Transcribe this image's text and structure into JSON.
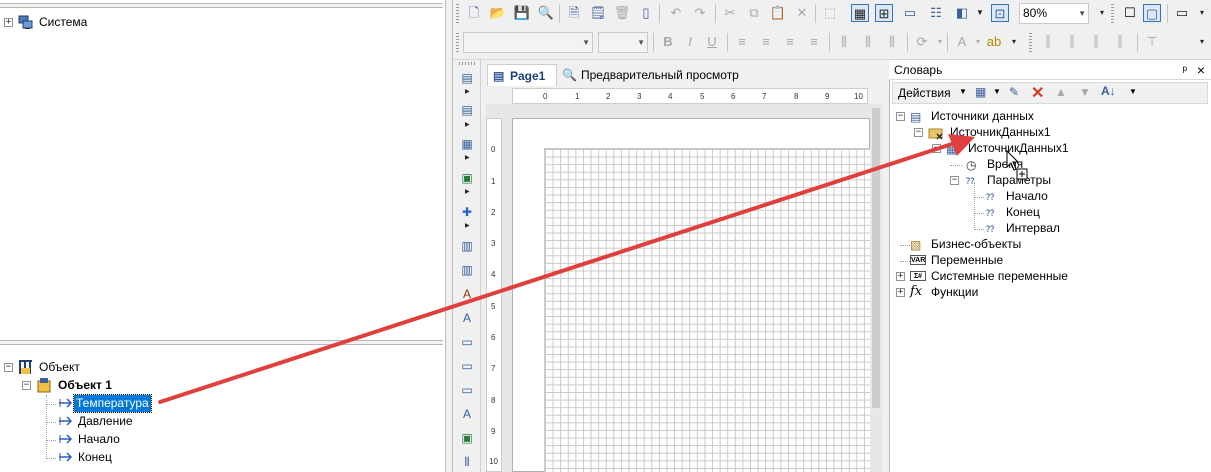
{
  "left_top_tree": {
    "items": [
      {
        "label": "Система"
      }
    ]
  },
  "left_bottom_tree": {
    "root": "Объект",
    "object": "Объект 1",
    "fields": [
      "Температура",
      "Давление",
      "Начало",
      "Конец"
    ]
  },
  "toolbar": {
    "zoom_value": "80%",
    "font_combo": "",
    "size_combo": ""
  },
  "designer": {
    "tabs": [
      "Page1",
      "Предварительный просмотр"
    ],
    "ruler_h": [
      "0",
      "1",
      "2",
      "3",
      "4",
      "5",
      "6",
      "7",
      "8",
      "9",
      "10"
    ],
    "ruler_v": [
      "0",
      "1",
      "2",
      "3",
      "4",
      "5",
      "6",
      "7",
      "8",
      "9",
      "10"
    ]
  },
  "dictionary": {
    "title": "Словарь",
    "pin": "ᵖ",
    "close": "×",
    "actions_label": "Действия",
    "items": [
      {
        "label": "Источники данных"
      },
      {
        "label": "ИсточникДанных1"
      },
      {
        "label": "ИсточникДанных1"
      },
      {
        "label": "Время"
      },
      {
        "label": "Параметры"
      },
      {
        "label": "Начало"
      },
      {
        "label": "Конец"
      },
      {
        "label": "Интервал"
      },
      {
        "label": "Бизнес-объекты"
      },
      {
        "label": "Переменные"
      },
      {
        "label": "Системные переменные"
      },
      {
        "label": "Функции"
      }
    ]
  },
  "colors": {
    "selection": "#0078d7",
    "arrow": "#e0403d",
    "toolbar_bg": "#f0f0f0"
  }
}
